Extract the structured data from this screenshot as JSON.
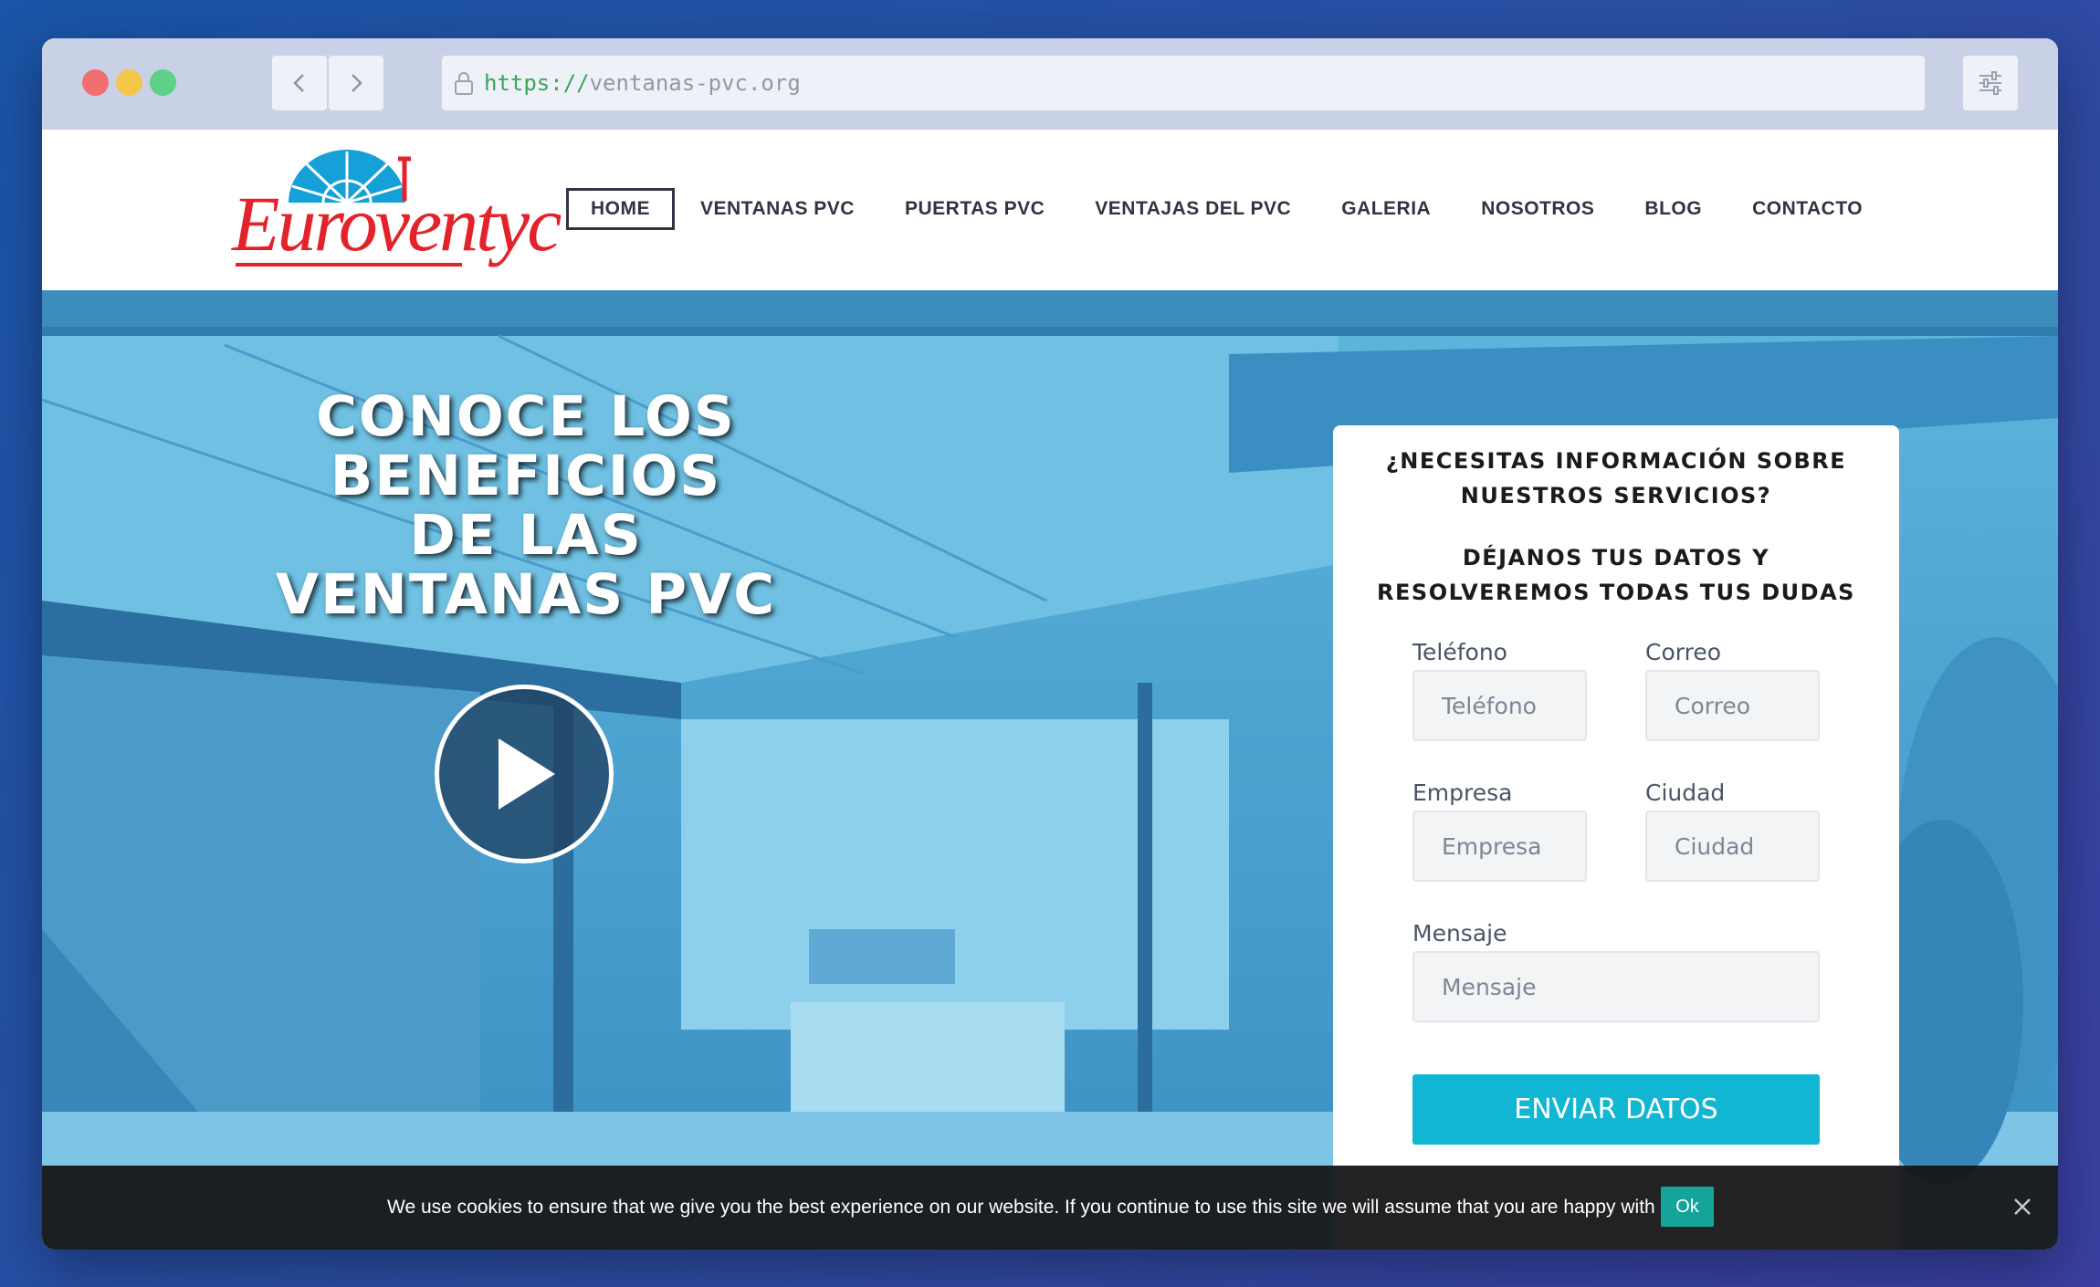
{
  "browser": {
    "url_scheme": "https://",
    "url_host": "ventanas-pvc.org",
    "icons": [
      "back-arrow-icon",
      "forward-arrow-icon",
      "lock-icon",
      "sliders-icon"
    ]
  },
  "header": {
    "logo_text": "Euroventyc",
    "nav": [
      "HOME",
      "VENTANAS PVC",
      "PUERTAS PVC",
      "VENTAJAS DEL PVC",
      "GALERIA",
      "NOSOTROS",
      "BLOG",
      "CONTACTO"
    ],
    "active_item": "HOME"
  },
  "hero": {
    "title_lines": [
      "CONOCE LOS",
      "BENEFICIOS",
      "DE LAS",
      "VENTANAS PVC"
    ],
    "play_icon": "play-icon"
  },
  "form": {
    "heading_1": [
      "¿NECESITAS INFORMACIÓN SOBRE",
      "NUESTROS SERVICIOS?"
    ],
    "heading_2": [
      "DÉJANOS TUS DATOS Y",
      "RESOLVEREMOS TODAS TUS DUDAS"
    ],
    "fields": {
      "telefono": {
        "label": "Teléfono",
        "placeholder": "Teléfono"
      },
      "correo": {
        "label": "Correo",
        "placeholder": "Correo"
      },
      "empresa": {
        "label": "Empresa",
        "placeholder": "Empresa"
      },
      "ciudad": {
        "label": "Ciudad",
        "placeholder": "Ciudad"
      },
      "mensaje": {
        "label": "Mensaje",
        "placeholder": "Mensaje"
      }
    },
    "submit_label": "ENVIAR DATOS"
  },
  "cookie": {
    "text": "We use cookies to ensure that we give you the best experience on our website. If you continue to use this site we will assume that you are happy with it.",
    "ok_label": "Ok"
  },
  "colors": {
    "accent": "#10b6d2",
    "brand_red": "#e3232b",
    "cookie_ok": "#15a49a"
  }
}
